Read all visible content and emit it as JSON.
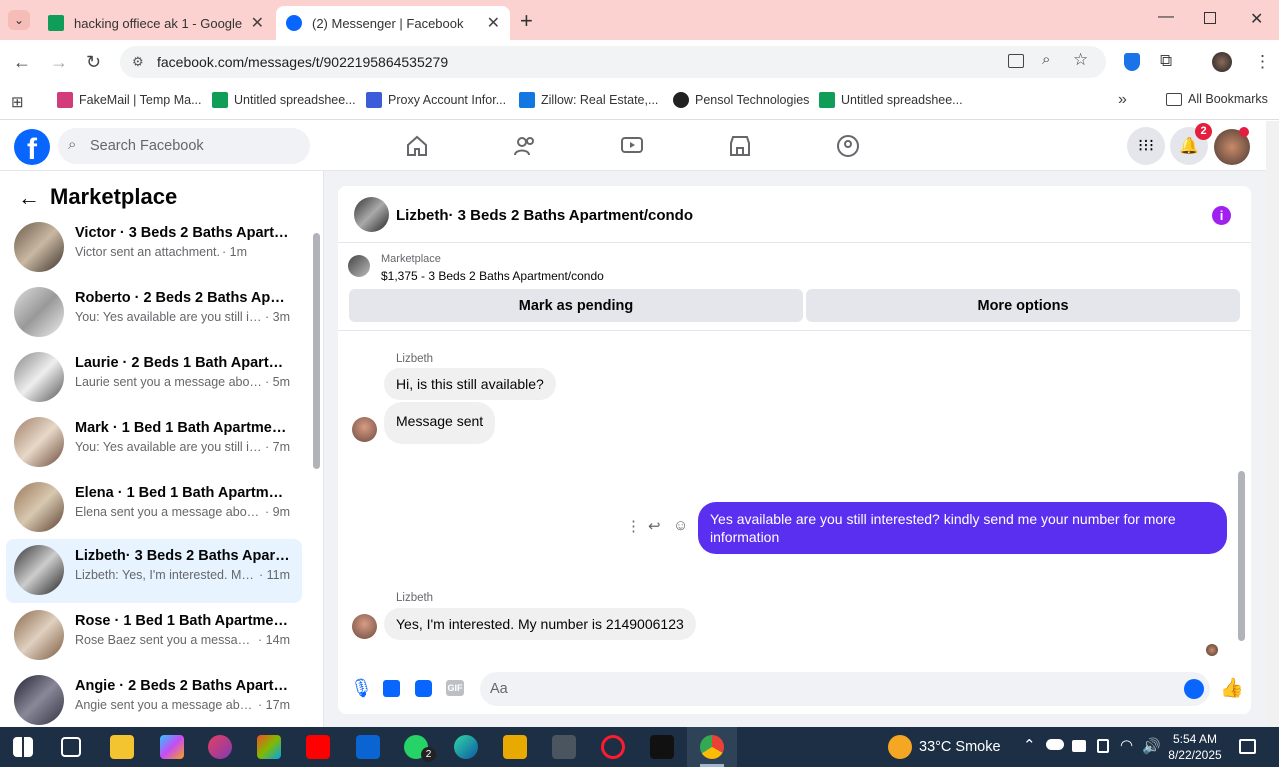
{
  "browser": {
    "tabs": [
      {
        "title": "hacking offiece ak 1 - Google S",
        "active": false
      },
      {
        "title": "(2) Messenger | Facebook",
        "active": true
      }
    ],
    "url": "facebook.com/messages/t/9022195864535279",
    "bookmarks": [
      "FakeMail | Temp Ma...",
      "Untitled spreadshee...",
      "Proxy Account Infor...",
      "Zillow: Real Estate,...",
      "Pensol Technologies",
      "Untitled spreadshee..."
    ],
    "all_bookmarks": "All Bookmarks"
  },
  "facebook": {
    "search_placeholder": "Search Facebook",
    "notification_count": "2"
  },
  "sidebar": {
    "title": "Marketplace",
    "conversations": [
      {
        "name": "Victor · 3 Beds 2 Baths Apartme...",
        "preview": "Victor sent an attachment.",
        "time": "· 1m"
      },
      {
        "name": "Roberto · 2 Beds 2 Baths Apart...",
        "preview": "You: Yes available are you still inter...",
        "time": "· 3m"
      },
      {
        "name": "Laurie · 2 Beds 1 Bath Apartmen...",
        "preview": "Laurie sent you a message about y...",
        "time": "· 5m"
      },
      {
        "name": "Mark · 1 Bed 1 Bath Apartment/...",
        "preview": "You: Yes available are you still inter...",
        "time": "· 7m"
      },
      {
        "name": "Elena · 1 Bed 1 Bath Apartment/...",
        "preview": "Elena sent you a message about y...",
        "time": "· 9m"
      },
      {
        "name": "Lizbeth· 3 Beds 2 Baths Apartm...",
        "preview": "Lizbeth: Yes, I'm interested. My n...",
        "time": "· 11m"
      },
      {
        "name": "Rose · 1 Bed 1 Bath Apartment/c...",
        "preview": "Rose Baez sent you a message a...",
        "time": "· 14m"
      },
      {
        "name": "Angie · 2 Beds 2 Baths Apartme...",
        "preview": "Angie sent you a message about ...",
        "time": "· 17m"
      }
    ]
  },
  "chat": {
    "title": "Lizbeth· 3 Beds 2 Baths Apartment/condo",
    "marketplace_label": "Marketplace",
    "listing": "$1,375 - 3 Beds 2 Baths Apartment/condo",
    "mark_pending": "Mark as pending",
    "more_options": "More options",
    "messages": [
      {
        "sender": "Lizbeth",
        "text": "Hi, is this still available?"
      },
      {
        "text": "Message sent"
      },
      {
        "from_me": true,
        "text": "Yes available are you still interested? kindly send me your number for more information"
      },
      {
        "sender": "Lizbeth",
        "text": "Yes, I'm interested. My number is 2149006123"
      }
    ],
    "composer_placeholder": "Aa"
  },
  "taskbar": {
    "weather": "33°C  Smoke",
    "time": "5:54 AM",
    "date": "8/22/2025",
    "whatsapp_badge": "2"
  }
}
